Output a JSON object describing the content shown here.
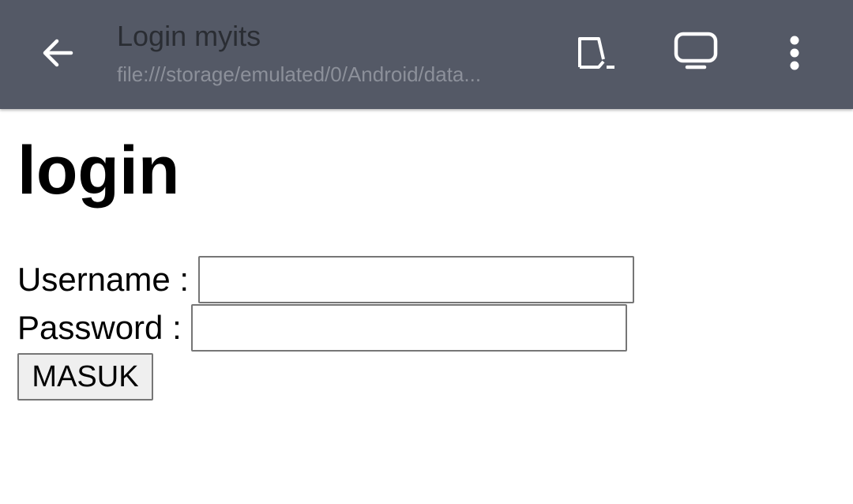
{
  "appbar": {
    "title": "Login myits",
    "url": "file:///storage/emulated/0/Android/data...",
    "icons": {
      "back": "arrow-back-icon",
      "cast": "cast-icon",
      "display": "tv-icon",
      "more": "more-vert-icon"
    },
    "colors": {
      "background": "#545966",
      "title": "#2a2d33",
      "url": "#8c909a"
    }
  },
  "page": {
    "heading": "login",
    "username_label": "Username :",
    "username_value": "",
    "password_label": "Password :",
    "password_value": "",
    "submit_label": "MASUK"
  }
}
